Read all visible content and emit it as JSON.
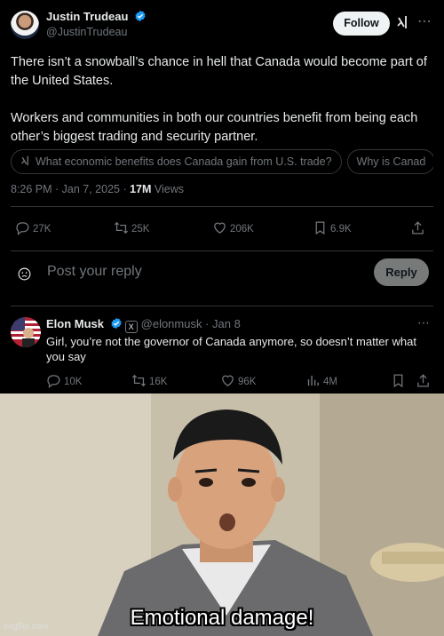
{
  "main_tweet": {
    "author_name": "Justin Trudeau",
    "author_handle": "@JustinTrudeau",
    "follow_label": "Follow",
    "paragraph_1": "There isn’t a snowball’s chance in hell that Canada would become part of the United States.",
    "paragraph_2": "Workers and communities in both our countries benefit from being each other’s biggest trading and security partner.",
    "grok_chips": [
      "What economic benefits does Canada gain from U.S. trade?",
      "Why is Canad"
    ],
    "timestamp": "8:26 PM · Jan 7, 2025 · ",
    "views_count": "17M",
    "views_label": " Views",
    "stats": {
      "replies": "27K",
      "reposts": "25K",
      "likes": "206K",
      "bookmarks": "6.9K"
    },
    "icons": [
      "verified-badge-icon",
      "grok-icon",
      "more-icon",
      "reply-icon",
      "repost-icon",
      "like-icon",
      "bookmark-icon",
      "share-icon"
    ]
  },
  "reply_composer": {
    "placeholder": "Post your reply",
    "button_label": "Reply"
  },
  "reply_tweet": {
    "author_name": "Elon Musk",
    "author_handle": "@elonmusk · Jan 8",
    "text": "Girl, you’re not the governor of Canada anymore, so doesn’t matter what you say",
    "stats": {
      "replies": "10K",
      "reposts": "16K",
      "likes": "96K",
      "views": "4M"
    }
  },
  "meme": {
    "caption": "Emotional damage!",
    "watermark": "imgflip.com"
  },
  "colors": {
    "background": "#000000",
    "text_primary": "#e7e9ea",
    "text_secondary": "#71767b",
    "verified_blue": "#1d9bf0",
    "divider": "#2f3336"
  }
}
